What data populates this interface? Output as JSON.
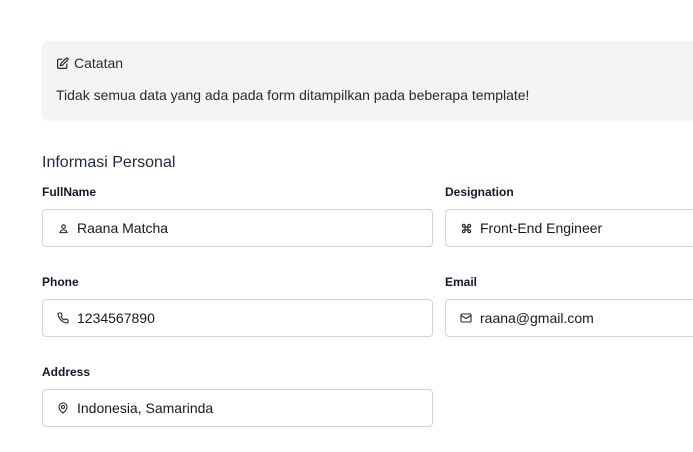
{
  "note": {
    "title": "Catatan",
    "text": "Tidak semua data yang ada pada form ditampilkan pada beberapa template!"
  },
  "section": {
    "title": "Informasi Personal"
  },
  "fields": {
    "fullname": {
      "label": "FullName",
      "value": "Raana Matcha",
      "icon": "user-icon"
    },
    "designation": {
      "label": "Designation",
      "value": "Front-End Engineer",
      "icon": "command-icon"
    },
    "phone": {
      "label": "Phone",
      "value": "1234567890",
      "icon": "phone-icon"
    },
    "email": {
      "label": "Email",
      "value": "raana@gmail.com",
      "icon": "mail-icon"
    },
    "address": {
      "label": "Address",
      "value": "Indonesia, Samarinda",
      "icon": "map-pin-icon"
    }
  }
}
